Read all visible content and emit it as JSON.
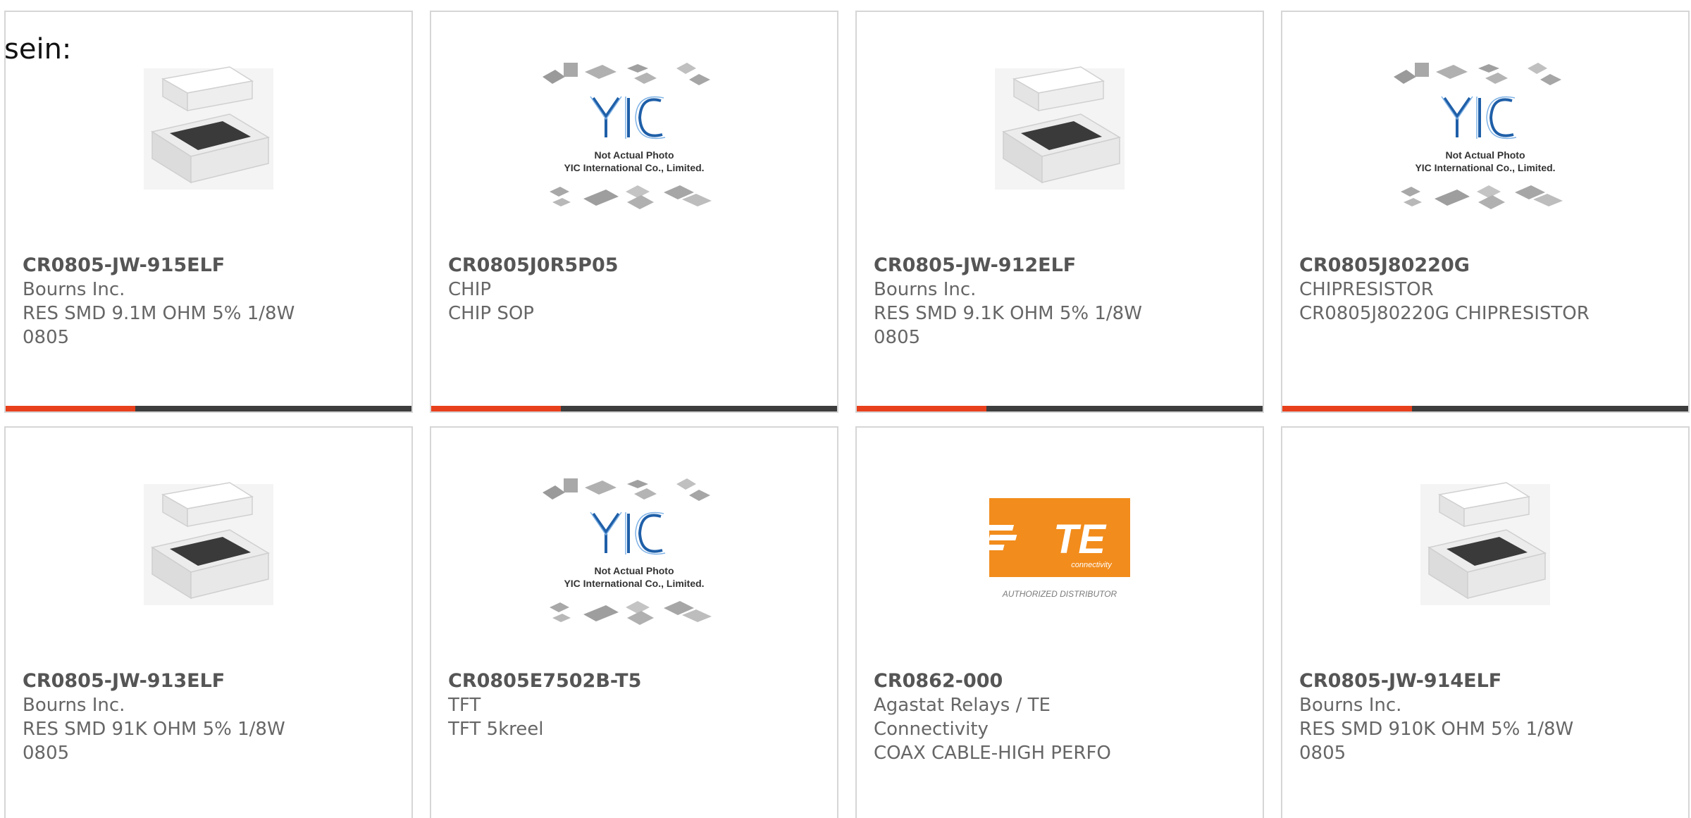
{
  "heading": "sein:",
  "accent_color": "#e8401c",
  "track_color": "#3d3d3d",
  "products": [
    {
      "image": "resistor-chip-photo",
      "part_number": "CR0805-JW-915ELF",
      "manufacturer": "Bourns Inc.",
      "description_line1": "RES SMD 9.1M OHM 5% 1/8W",
      "description_line2": "0805",
      "progress": 0.32
    },
    {
      "image": "yic-not-actual-photo",
      "image_text_line1": "Not Actual Photo",
      "image_text_line2": "YIC International Co., Limited.",
      "part_number": "CR0805J0R5P05",
      "manufacturer": "CHIP",
      "description_line1": "CHIP SOP",
      "description_line2": "",
      "progress": 0.32
    },
    {
      "image": "resistor-chip-photo",
      "part_number": "CR0805-JW-912ELF",
      "manufacturer": "Bourns Inc.",
      "description_line1": "RES SMD 9.1K OHM 5% 1/8W",
      "description_line2": "0805",
      "progress": 0.32
    },
    {
      "image": "yic-not-actual-photo",
      "image_text_line1": "Not Actual Photo",
      "image_text_line2": "YIC International Co., Limited.",
      "part_number": "CR0805J80220G",
      "manufacturer": "CHIPRESISTOR",
      "description_line1": "CR0805J80220G CHIPRESISTOR",
      "description_line2": "",
      "progress": 0.32
    },
    {
      "image": "resistor-chip-photo",
      "part_number": "CR0805-JW-913ELF",
      "manufacturer": "Bourns Inc.",
      "description_line1": "RES SMD 91K OHM 5% 1/8W",
      "description_line2": "0805"
    },
    {
      "image": "yic-not-actual-photo",
      "image_text_line1": "Not Actual Photo",
      "image_text_line2": "YIC International Co., Limited.",
      "part_number": "CR0805E7502B-T5",
      "manufacturer": "TFT",
      "description_line1": "TFT 5kreel",
      "description_line2": ""
    },
    {
      "image": "te-connectivity-logo",
      "logo_text": "TE",
      "logo_subtext": "connectivity",
      "logo_caption": "AUTHORIZED DISTRIBUTOR",
      "logo_color": "#f28c1c",
      "part_number": "CR0862-000",
      "manufacturer": "Agastat Relays / TE Connectivity",
      "description_line1": "COAX CABLE-HIGH PERFO",
      "description_line2": ""
    },
    {
      "image": "resistor-chip-photo",
      "part_number": "CR0805-JW-914ELF",
      "manufacturer": "Bourns Inc.",
      "description_line1": "RES SMD 910K OHM 5% 1/8W",
      "description_line2": "0805"
    }
  ]
}
